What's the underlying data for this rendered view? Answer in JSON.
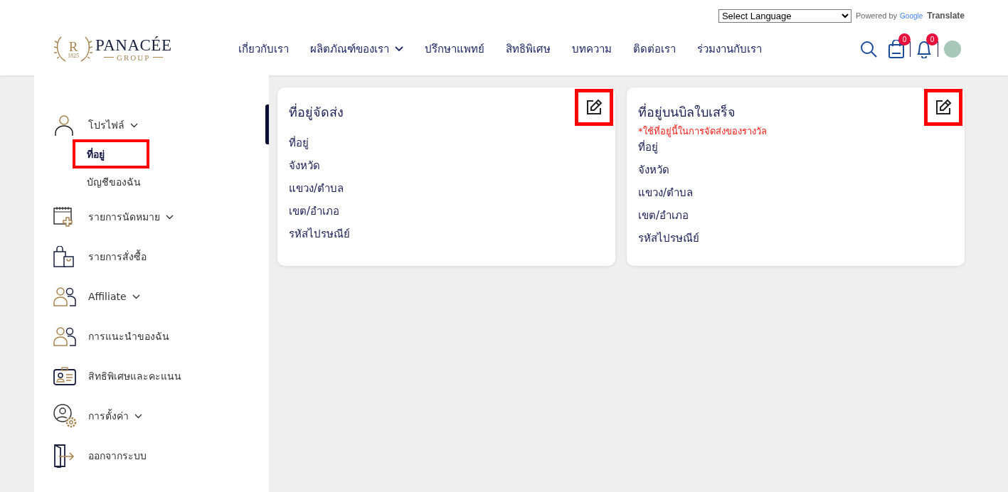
{
  "language_bar": {
    "select": "Select Language",
    "powered_by": "Powered by",
    "google": "Google",
    "translate": "Translate"
  },
  "logo": {
    "monogram": "R",
    "year": "1825",
    "name": "PANACÉE",
    "tagline": "GROUP"
  },
  "nav": [
    {
      "label": "เกี่ยวกับเรา"
    },
    {
      "label": "ผลิตภัณฑ์ของเรา",
      "dropdown": true
    },
    {
      "label": "ปรึกษาแพทย์"
    },
    {
      "label": "สิทธิพิเศษ"
    },
    {
      "label": "บทความ"
    },
    {
      "label": "ติดต่อเรา"
    },
    {
      "label": "ร่วมงานกับเรา"
    }
  ],
  "header_icons": {
    "cart_count": "0",
    "notification_count": "0"
  },
  "sidebar": {
    "items": [
      {
        "label": "โปรไฟล์",
        "dropdown": true,
        "children": [
          {
            "label": "ที่อยู่",
            "selected": true,
            "highlighted": true
          },
          {
            "label": "บัญชีของฉัน",
            "selected": false,
            "highlighted": false
          }
        ]
      },
      {
        "label": "รายการนัดหมาย",
        "dropdown": true
      },
      {
        "label": "รายการสั่งซื้อ"
      },
      {
        "label": "Affiliate",
        "dropdown": true
      },
      {
        "label": "การแนะนำของฉัน"
      },
      {
        "label": "สิทธิพิเศษและคะแนน"
      },
      {
        "label": "การตั้งค่า",
        "dropdown": true
      },
      {
        "label": "ออกจากระบบ"
      }
    ]
  },
  "cards": [
    {
      "title": "ที่อยู่จัดส่ง",
      "edit_highlighted": true,
      "fields": [
        "ที่อยู่",
        "จังหวัด",
        "แขวง/ตำบล",
        "เขต/อำเภอ",
        "รหัสไปรษณีย์"
      ]
    },
    {
      "title": "ที่อยู่บนบิลใบเสร็จ",
      "note": "*ใช้ที่อยู่นี้ในการจัดส่งของรางวัล",
      "edit_highlighted": true,
      "fields": [
        "ที่อยู่",
        "จังหวัด",
        "แขวง/ตำบล",
        "เขต/อำเภอ",
        "รหัสไปรษณีย์"
      ]
    }
  ]
}
